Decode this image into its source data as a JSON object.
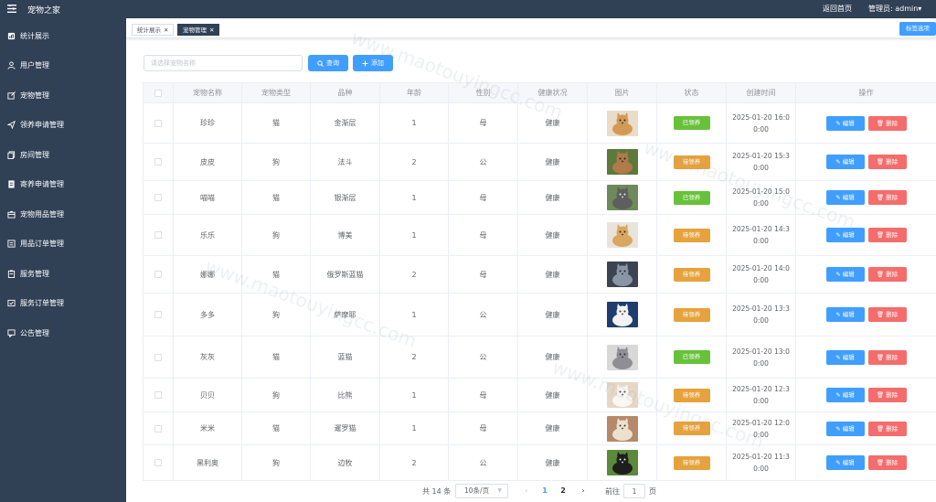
{
  "header": {
    "app_title": "宠物之家",
    "home_link": "返回首页",
    "admin_label": "管理员: admin▾"
  },
  "sidebar": {
    "items": [
      {
        "label": "统计展示",
        "icon": "chart-icon"
      },
      {
        "label": "用户管理",
        "icon": "user-icon"
      },
      {
        "label": "宠物管理",
        "icon": "edit-box-icon"
      },
      {
        "label": "领养申请管理",
        "icon": "send-icon"
      },
      {
        "label": "房间管理",
        "icon": "copy-icon"
      },
      {
        "label": "寄养申请管理",
        "icon": "document-icon"
      },
      {
        "label": "宠物用品管理",
        "icon": "box-icon"
      },
      {
        "label": "用品订单管理",
        "icon": "list-icon"
      },
      {
        "label": "服务管理",
        "icon": "clipboard-icon"
      },
      {
        "label": "服务订单管理",
        "icon": "order-icon"
      },
      {
        "label": "公告管理",
        "icon": "message-icon"
      }
    ]
  },
  "tags": [
    {
      "label": "统计展示",
      "active": false
    },
    {
      "label": "宠物管理",
      "active": true
    }
  ],
  "tag_options_label": "标签选项",
  "search": {
    "placeholder": "请选择宠物名称",
    "value": "",
    "query_label": "查询",
    "add_label": "添加"
  },
  "table": {
    "headers": [
      "宠物名称",
      "宠物类型",
      "品种",
      "年龄",
      "性别",
      "健康状况",
      "图片",
      "状态",
      "创建时间",
      "操作"
    ],
    "edit_label": "编辑",
    "delete_label": "删除",
    "rows": [
      {
        "name": "珍珍",
        "type": "猫",
        "breed": "金渐层",
        "age": "1",
        "gender": "母",
        "health": "健康",
        "status": "已领养",
        "time": "2025-01-20 16:00:00",
        "img": "orange-cat"
      },
      {
        "name": "皮皮",
        "type": "狗",
        "breed": "法斗",
        "age": "2",
        "gender": "公",
        "health": "健康",
        "status": "待领养",
        "time": "2025-01-20 15:30:00",
        "img": "brown-dog"
      },
      {
        "name": "喵喵",
        "type": "猫",
        "breed": "银渐层",
        "age": "1",
        "gender": "母",
        "health": "健康",
        "status": "已领养",
        "time": "2025-01-20 15:00:00",
        "img": "gray-cat"
      },
      {
        "name": "乐乐",
        "type": "狗",
        "breed": "博美",
        "age": "1",
        "gender": "母",
        "health": "健康",
        "status": "待领养",
        "time": "2025-01-20 14:30:00",
        "img": "golden-dog"
      },
      {
        "name": "娜娜",
        "type": "猫",
        "breed": "俄罗斯蓝猫",
        "age": "2",
        "gender": "母",
        "health": "健康",
        "status": "待领养",
        "time": "2025-01-20 14:00:00",
        "img": "blue-cat"
      },
      {
        "name": "多多",
        "type": "狗",
        "breed": "萨摩耶",
        "age": "1",
        "gender": "公",
        "health": "健康",
        "status": "待领养",
        "time": "2025-01-20 13:30:00",
        "img": "white-dog"
      },
      {
        "name": "灰灰",
        "type": "猫",
        "breed": "蓝猫",
        "age": "2",
        "gender": "公",
        "health": "健康",
        "status": "已领养",
        "time": "2025-01-20 13:00:00",
        "img": "gray-cat-2"
      },
      {
        "name": "贝贝",
        "type": "狗",
        "breed": "比熊",
        "age": "1",
        "gender": "母",
        "health": "健康",
        "status": "待领养",
        "time": "2025-01-20 12:30:00",
        "img": "bichon"
      },
      {
        "name": "米米",
        "type": "猫",
        "breed": "暹罗猫",
        "age": "1",
        "gender": "母",
        "health": "健康",
        "status": "待领养",
        "time": "2025-01-20 12:00:00",
        "img": "siamese"
      },
      {
        "name": "黑利奥",
        "type": "狗",
        "breed": "边牧",
        "age": "2",
        "gender": "公",
        "health": "健康",
        "status": "待领养",
        "time": "2025-01-20 11:30:00",
        "img": "collie"
      }
    ]
  },
  "pagination": {
    "total": "共 14 条",
    "page_size": "10条/页",
    "pages": [
      "1",
      "2"
    ],
    "current": "1",
    "goto_label": "前往",
    "goto_value": "1",
    "page_unit": "页"
  },
  "colors": {
    "sidebar_bg": "#304156",
    "primary": "#409eff",
    "danger": "#f56c6c",
    "adopted": "#67c23a",
    "waiting": "#e6a23c"
  }
}
